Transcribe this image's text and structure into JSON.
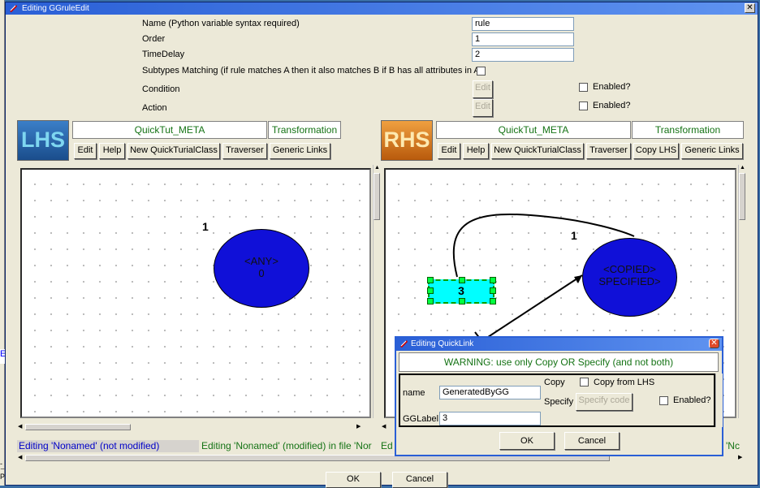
{
  "main_window": {
    "title": "Editing GGruleEdit",
    "fields": {
      "name_label": "Name (Python variable syntax required)",
      "name_value": "rule",
      "order_label": "Order",
      "order_value": "1",
      "timedelay_label": "TimeDelay",
      "timedelay_value": "2",
      "subtypes_label": "Subtypes Matching (if rule matches A then it also matches B if B has all attributes in A)",
      "condition_label": "Condition",
      "action_label": "Action",
      "edit_label": "Edit",
      "enabled_label": "Enabled?"
    }
  },
  "lhs": {
    "logo_text": "LHS",
    "meta_name": "QuickTut_META",
    "transformation": "Transformation",
    "buttons": [
      "Edit",
      "Help",
      "New QuickTurialClass",
      "Traverser",
      "Generic Links"
    ],
    "node_number": "1",
    "node_text_1": "<ANY>",
    "node_text_2": "0",
    "status": "Editing 'Nonamed' (not modified)"
  },
  "rhs": {
    "logo_text": "RHS",
    "meta_name": "QuickTut_META",
    "transformation": "Transformation",
    "buttons": [
      "Edit",
      "Help",
      "New QuickTurialClass",
      "Traverser",
      "Copy LHS",
      "Generic Links"
    ],
    "node_number": "1",
    "node_text_1": "<COPIED>",
    "node_text_2": "SPECIFIED>",
    "link_number": "3",
    "status": "Editing 'Nonamed' (modified) in file 'Nor",
    "status_right": "'Nc"
  },
  "left_edge_fragments": [
    "Ec",
    "P",
    "-E"
  ],
  "bottom_buttons": {
    "ok": "OK",
    "cancel": "Cancel"
  },
  "dialog": {
    "title": "Editing QuickLink",
    "warning": "WARNING: use only Copy OR Specify (and not both)",
    "name_label": "name",
    "name_value": "GeneratedByGG",
    "gglabel_label": "GGLabel",
    "gglabel_value": "3",
    "copy_label": "Copy",
    "copy_from_lhs": "Copy from LHS",
    "specify_label": "Specify",
    "specify_code": "Specify code",
    "enabled_label": "Enabled?",
    "ok": "OK",
    "cancel": "Cancel"
  },
  "colors": {
    "title_blue": "#2a5fd6",
    "node_blue": "#1010d8",
    "link_cyan": "#00ffff",
    "green_text": "#157315",
    "status_blue": "#0000c8",
    "lhs_logo_bg": "#1f5fa8",
    "rhs_logo_bg": "#d97a16"
  }
}
